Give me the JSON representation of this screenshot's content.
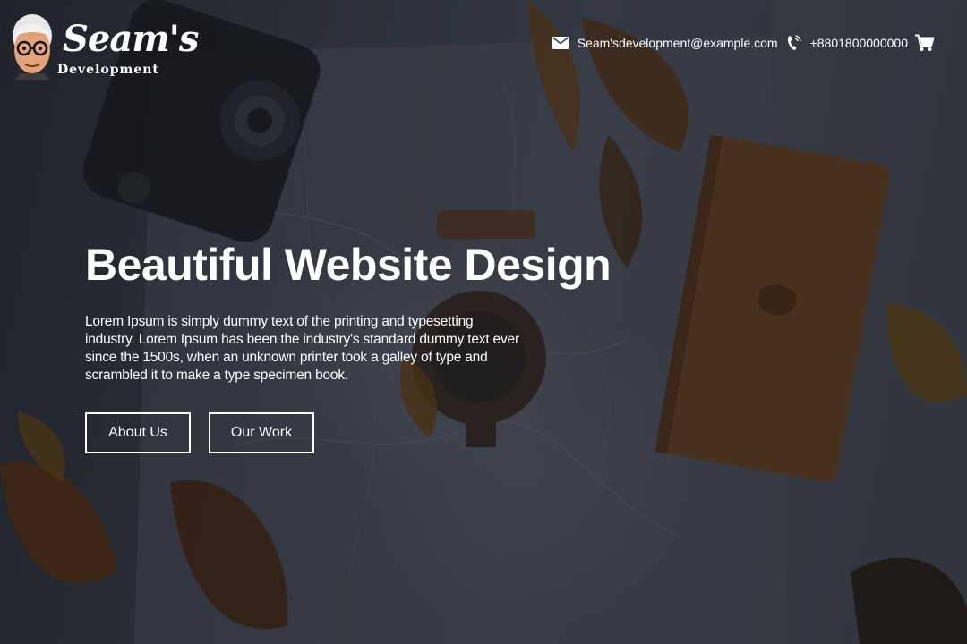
{
  "brand": {
    "title": "Seam's",
    "subtitle": "Development"
  },
  "header": {
    "email": "Seam'sdevelopment@example.com",
    "phone": "+8801800000000",
    "icons": [
      "mail-icon",
      "phone-icon",
      "cart-icon",
      "logo-avatar-icon"
    ]
  },
  "hero": {
    "heading": "Beautiful Website Design",
    "body": "Lorem Ipsum is simply dummy text of the printing and typesetting industry. Lorem Ipsum has been the industry's standard dummy text ever since the 1500s, when an unknown printer took a galley of type and scrambled it to make a type specimen book.",
    "buttons": [
      {
        "label": "About Us"
      },
      {
        "label": "Our Work"
      }
    ]
  },
  "colors": {
    "text": "#ffffff",
    "overlay": "#1c2028"
  }
}
